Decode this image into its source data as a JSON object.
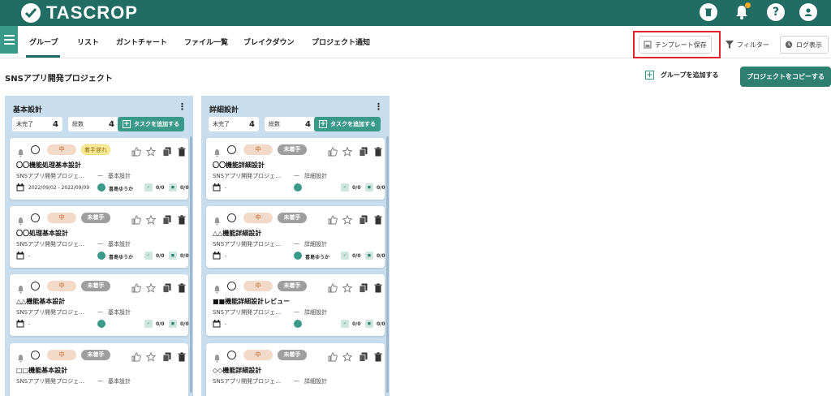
{
  "app": {
    "name": "TASCROP"
  },
  "header": {
    "icons": [
      "trash-icon",
      "bell-icon",
      "help-icon",
      "user-icon"
    ],
    "help_label": "?"
  },
  "tabs": [
    {
      "label": "グループ",
      "active": true
    },
    {
      "label": "リスト"
    },
    {
      "label": "ガントチャート"
    },
    {
      "label": "ファイル一覧"
    },
    {
      "label": "ブレイクダウン"
    },
    {
      "label": "プロジェクト通知"
    }
  ],
  "toolbar": {
    "template_save": "テンプレート保存",
    "filter": "フィルター",
    "log": "ログ表示"
  },
  "project": {
    "title": "SNSアプリ開発プロジェクト",
    "add_group": "グループを追加する",
    "copy": "プロジェクトをコピーする"
  },
  "columns": [
    {
      "title": "基本設計",
      "incomplete_label": "未完了",
      "incomplete": "4",
      "total_label": "総数",
      "total": "4",
      "add_task": "タスクを追加する",
      "cards": [
        {
          "priority": "中",
          "status": "着手遅れ",
          "status_type": "late",
          "title": "〇〇機能処理基本設計",
          "project": "SNSアプリ開発プロジェ…",
          "dash": "—",
          "phase": "基本設計",
          "dates": "2022/09/02 - 2022/09/09",
          "user": "喜島ゆうか",
          "c1": "0/0",
          "c2": "0/0"
        },
        {
          "priority": "中",
          "status": "未着手",
          "status_type": "not",
          "title": "〇〇処理基本設計",
          "project": "SNSアプリ開発プロジェ…",
          "dash": "—",
          "phase": "基本設計",
          "dates": "-",
          "user": "喜島ゆうか",
          "c1": "0/0",
          "c2": "0/0"
        },
        {
          "priority": "中",
          "status": "未着手",
          "status_type": "not",
          "title": "△△機能基本設計",
          "project": "SNSアプリ開発プロジェ…",
          "dash": "—",
          "phase": "基本設計",
          "dates": "-",
          "user": "",
          "c1": "0/0",
          "c2": "0/0"
        },
        {
          "priority": "中",
          "status": "未着手",
          "status_type": "not",
          "title": "□□機能基本設計",
          "project": "SNSアプリ開発プロジェ…",
          "dash": "—",
          "phase": "基本設計",
          "dates": "",
          "user": "",
          "c1": "",
          "c2": ""
        }
      ]
    },
    {
      "title": "詳細設計",
      "incomplete_label": "未完了",
      "incomplete": "4",
      "total_label": "総数",
      "total": "4",
      "add_task": "タスクを追加する",
      "cards": [
        {
          "priority": "中",
          "status": "未着手",
          "status_type": "not",
          "title": "〇〇機能詳細設計",
          "project": "SNSアプリ開発プロジェ…",
          "dash": "—",
          "phase": "詳細設計",
          "dates": "-",
          "user": "",
          "c1": "0/0",
          "c2": "0/0"
        },
        {
          "priority": "中",
          "status": "未着手",
          "status_type": "not",
          "title": "△△機能詳細設計",
          "project": "SNSアプリ開発プロジェ…",
          "dash": "—",
          "phase": "詳細設計",
          "dates": "-",
          "user": "喜島ゆうか",
          "c1": "0/0",
          "c2": "0/0"
        },
        {
          "priority": "中",
          "status": "未着手",
          "status_type": "not",
          "title": "■■機能詳細設計レビュー",
          "project": "SNSアプリ開発プロジェ…",
          "dash": "—",
          "phase": "詳細設計",
          "dates": "-",
          "user": "",
          "c1": "0/0",
          "c2": "0/0"
        },
        {
          "priority": "中",
          "status": "未着手",
          "status_type": "not",
          "title": "◇◇機能詳細設計",
          "project": "SNSアプリ開発プロジェ…",
          "dash": "—",
          "phase": "詳細設計",
          "dates": "",
          "user": "",
          "c1": "",
          "c2": ""
        }
      ]
    }
  ]
}
